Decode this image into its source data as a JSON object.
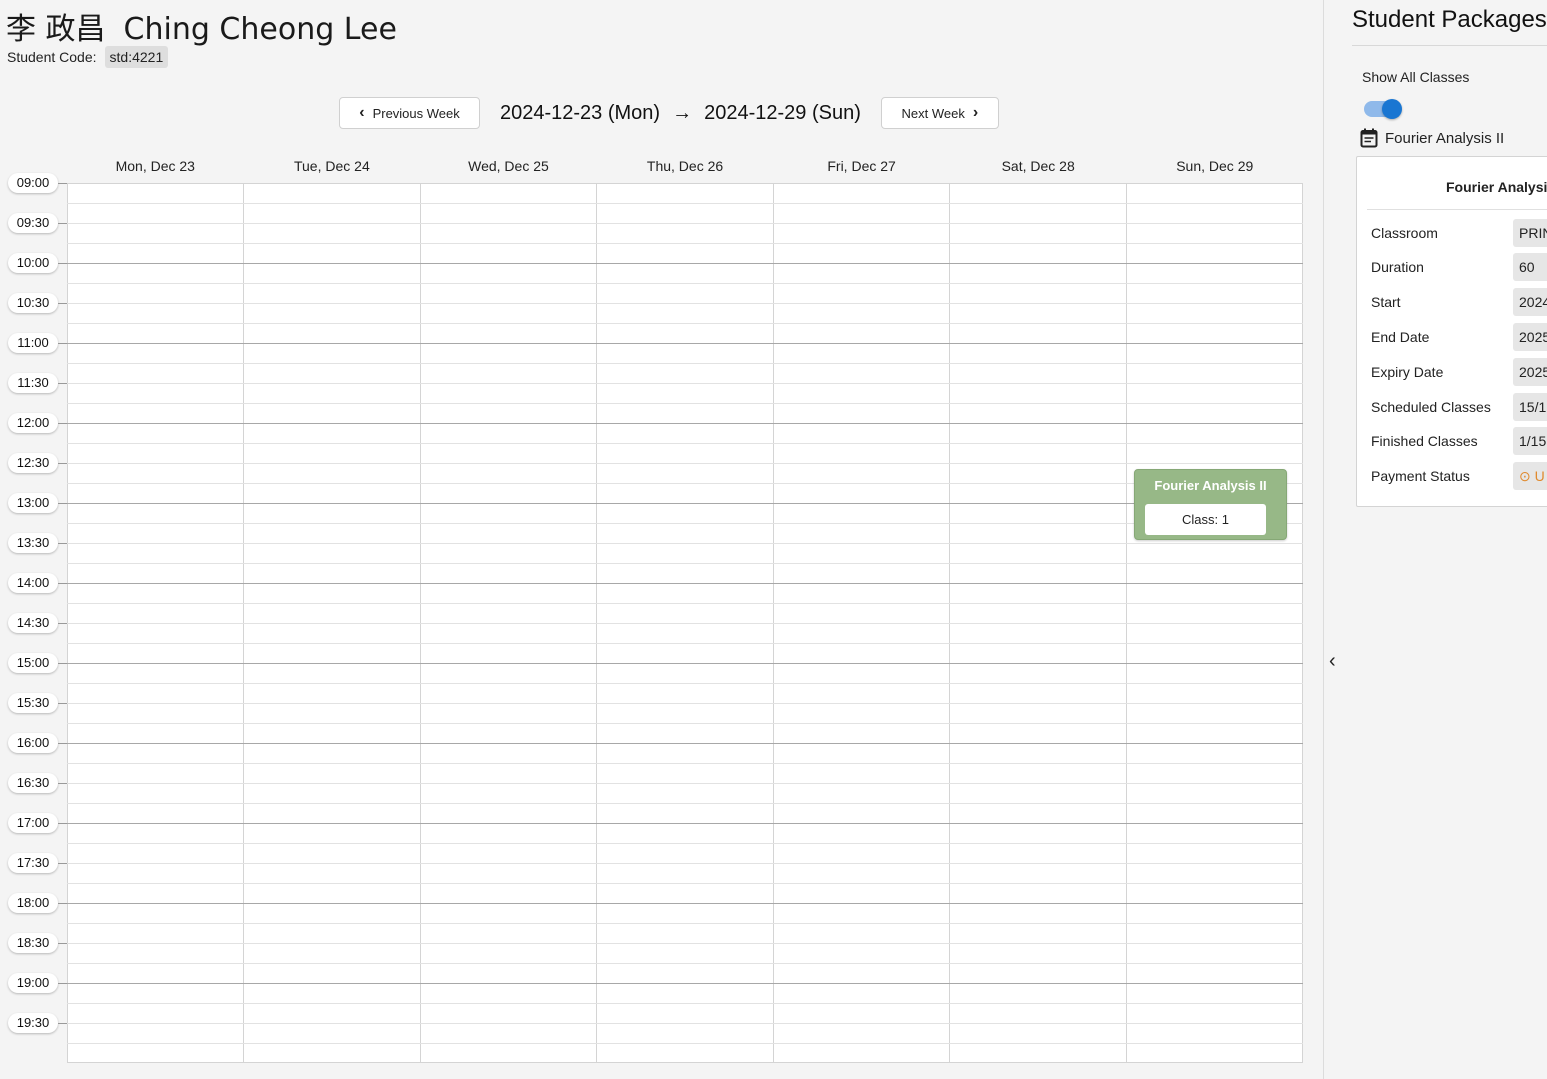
{
  "student": {
    "chinese_name": "李 政昌",
    "english_name": "Ching Cheong Lee",
    "code_label": "Student Code:",
    "code": "std:4221"
  },
  "week_nav": {
    "prev_label": "Previous Week",
    "next_label": "Next Week",
    "start": "2024-12-23 (Mon)",
    "end": "2024-12-29 (Sun)"
  },
  "days": [
    "Mon, Dec 23",
    "Tue, Dec 24",
    "Wed, Dec 25",
    "Thu, Dec 26",
    "Fri, Dec 27",
    "Sat, Dec 28",
    "Sun, Dec 29"
  ],
  "times": [
    "09:00",
    "09:30",
    "10:00",
    "10:30",
    "11:00",
    "11:30",
    "12:00",
    "12:30",
    "13:00",
    "13:30",
    "14:00",
    "14:30",
    "15:00",
    "15:30",
    "16:00",
    "16:30",
    "17:00",
    "17:30",
    "18:00",
    "18:30",
    "19:00",
    "19:30"
  ],
  "event": {
    "title": "Fourier Analysis II",
    "class_label": "Class: 1",
    "day": "Sun, Dec 29",
    "start": "12:45",
    "color": "#97b887"
  },
  "panel": {
    "title": "Student Packages",
    "show_all_label": "Show All Classes",
    "show_all_on": true,
    "package_name": "Fourier Analysis II",
    "package_icon": "calendar-icon",
    "card_title": "Fourier Analysis",
    "fields": [
      {
        "label": "Classroom",
        "value": "PRIN"
      },
      {
        "label": "Duration",
        "value": "60"
      },
      {
        "label": "Start",
        "value": "2024"
      },
      {
        "label": "End Date",
        "value": "2025"
      },
      {
        "label": "Expiry Date",
        "value": "2025"
      },
      {
        "label": "Scheduled Classes",
        "value": "15/1"
      },
      {
        "label": "Finished Classes",
        "value": "1/15"
      },
      {
        "label": "Payment Status",
        "value": "U"
      }
    ],
    "accent_color": "#1976d2",
    "payment_color": "#e08a2e"
  }
}
